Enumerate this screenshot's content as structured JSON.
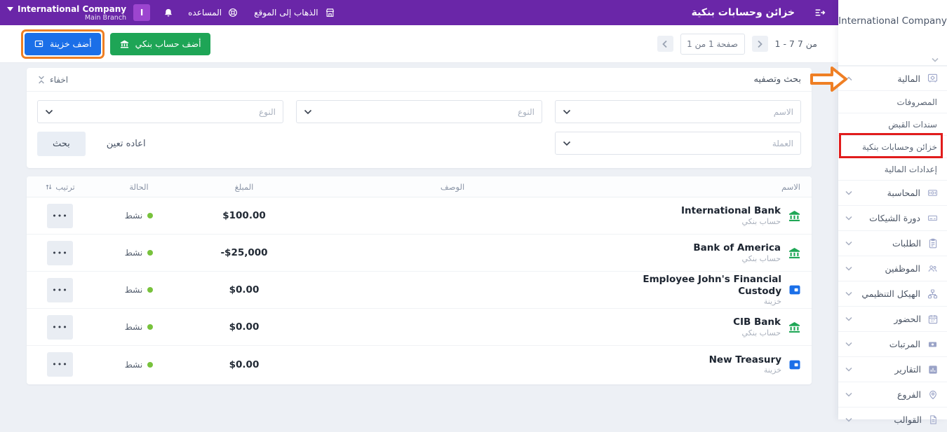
{
  "colors": {
    "topbar_purple": "#6a26a8",
    "accent_blue": "#1b6fe8",
    "accent_green": "#1ea556",
    "annotation_orange": "#ef7f24",
    "annotation_red": "#e11c1c",
    "status_green": "#78c23c"
  },
  "topbar": {
    "company": "International Company",
    "branch": "Main Branch",
    "avatar_letter": "I",
    "help_label": "المساعده",
    "goto_site_label": "الذهاب إلى الموقع",
    "page_title": "خزائن وحسابات بنكية",
    "icons": [
      "caret-down-icon",
      "bell-icon",
      "lifebuoy-icon",
      "storefront-icon",
      "sidebar-toggle-icon"
    ]
  },
  "toolbar": {
    "add_treasury_label": "أضف خزينة",
    "add_bank_account_label": "أضف حساب بنكي",
    "pagination": {
      "range": "1 - 7 من 7",
      "page": "صفحة 1 من 1"
    }
  },
  "filters": {
    "title": "بحث وتصفيه",
    "hide_label": "اخفاء",
    "name_placeholder": "الاسم",
    "type_placeholder": "النوع",
    "type2_placeholder": "النوع",
    "currency_placeholder": "العملة",
    "search_label": "بحث",
    "reset_label": "اعاده تعين"
  },
  "table": {
    "headers": {
      "name": "الاسم",
      "description": "الوصف",
      "amount": "المبلغ",
      "status": "الحالة",
      "order": "ترتيب"
    },
    "row_action_label": "•••",
    "rows": [
      {
        "name": "International Bank",
        "type": "حساب بنكي",
        "icon": "bank-icon",
        "description": "",
        "amount": "$100.00",
        "status": "نشط"
      },
      {
        "name": "Bank of America",
        "type": "حساب بنكي",
        "icon": "bank-icon",
        "description": "",
        "amount": "-$25,000",
        "status": "نشط"
      },
      {
        "name": "Employee John's Financial Custody",
        "type": "خزينة",
        "icon": "treasury-icon",
        "description": "",
        "amount": "$0.00",
        "status": "نشط"
      },
      {
        "name": "CIB Bank",
        "type": "حساب بنكي",
        "icon": "bank-icon",
        "description": "",
        "amount": "$0.00",
        "status": "نشط"
      },
      {
        "name": "New Treasury",
        "type": "خزينة",
        "icon": "treasury-icon",
        "description": "",
        "amount": "$0.00",
        "status": "نشط"
      }
    ]
  },
  "sidebar": {
    "company_name": "International Company",
    "finance": {
      "label": "المالية",
      "icon": "safe-icon",
      "expanded": true,
      "children": [
        {
          "label": "المصروفات"
        },
        {
          "label": "سندات القبض"
        },
        {
          "label": "خزائن وحسابات بنكية",
          "highlighted": true
        },
        {
          "label": "إعدادات المالية"
        }
      ]
    },
    "items": [
      {
        "label": "المحاسبة",
        "icon": "cash-icon"
      },
      {
        "label": "دورة الشيكات",
        "icon": "cheque-icon"
      },
      {
        "label": "الطلبات",
        "icon": "clipboard-icon"
      },
      {
        "label": "الموظفين",
        "icon": "people-icon"
      },
      {
        "label": "الهيكل التنظيمي",
        "icon": "org-chart-icon"
      },
      {
        "label": "الحضور",
        "icon": "calendar-icon"
      },
      {
        "label": "المرتبات",
        "icon": "banknote-icon"
      },
      {
        "label": "التقارير",
        "icon": "bar-chart-icon"
      },
      {
        "label": "الفروع",
        "icon": "map-pin-icon"
      },
      {
        "label": "القوالب",
        "icon": "document-icon"
      }
    ]
  }
}
